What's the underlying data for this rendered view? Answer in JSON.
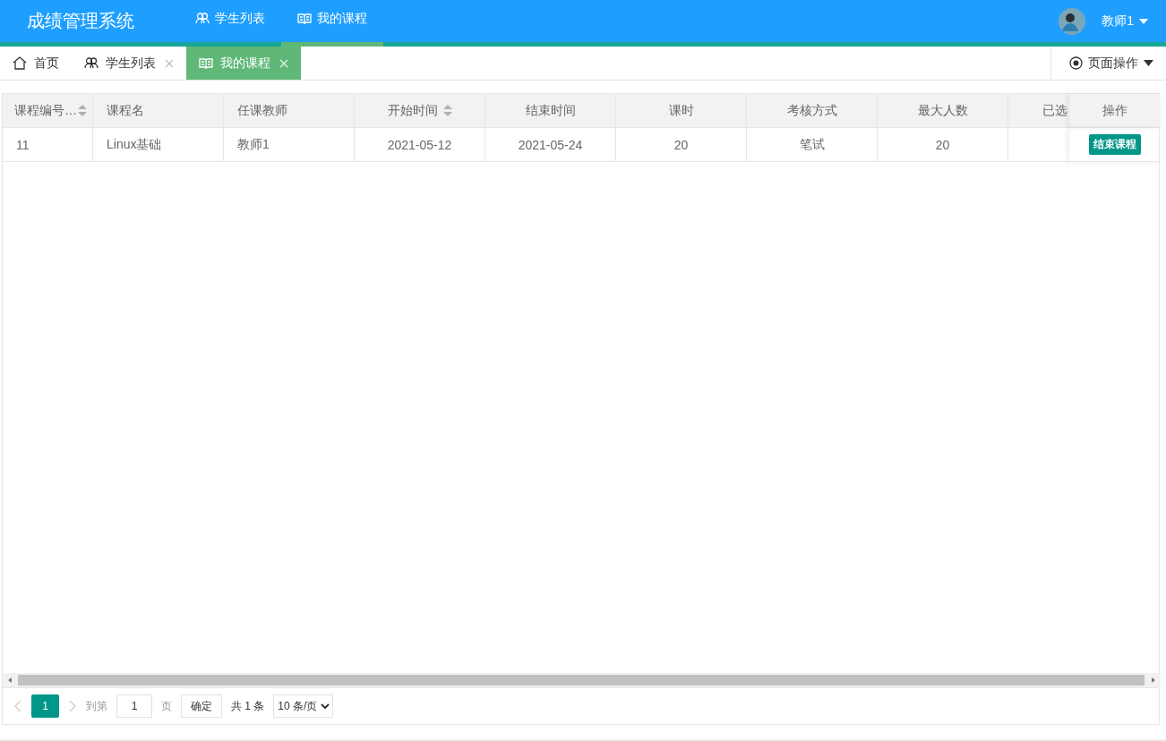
{
  "header": {
    "title": "成绩管理系统",
    "nav": [
      {
        "label": "学生列表",
        "kind": "users",
        "selected": false
      },
      {
        "label": "我的课程",
        "kind": "book",
        "selected": true
      }
    ],
    "user": {
      "name": "教师1"
    }
  },
  "tabs": [
    {
      "label": "首页",
      "kind": "home",
      "closable": false,
      "selected": false
    },
    {
      "label": "学生列表",
      "kind": "users",
      "closable": true,
      "selected": false
    },
    {
      "label": "我的课程",
      "kind": "book",
      "closable": true,
      "selected": true
    }
  ],
  "page_actions": {
    "label": "页面操作"
  },
  "table": {
    "columns": [
      {
        "label": "课程编号…",
        "sortable": true,
        "kind": "text"
      },
      {
        "label": "课程名",
        "sortable": false,
        "kind": "text"
      },
      {
        "label": "任课教师",
        "sortable": false,
        "kind": "text"
      },
      {
        "label": "开始时间",
        "sortable": true,
        "kind": "date"
      },
      {
        "label": "结束时间",
        "sortable": false,
        "kind": "date"
      },
      {
        "label": "课时",
        "sortable": false,
        "kind": "number"
      },
      {
        "label": "考核方式",
        "sortable": false,
        "kind": "number"
      },
      {
        "label": "最大人数",
        "sortable": false,
        "kind": "number"
      },
      {
        "label": "已选",
        "sortable": false,
        "kind": "cut"
      }
    ],
    "action_column": "操作",
    "rows": [
      {
        "cells": [
          "11",
          "Linux基础",
          "教师1",
          "2021-05-12",
          "2021-05-24",
          "20",
          "笔试",
          "20"
        ],
        "actions": [
          "结束课程"
        ]
      }
    ]
  },
  "pager": {
    "pages": [
      {
        "label": "1",
        "selected": true
      }
    ],
    "goto_label": "到第",
    "page_input": "1",
    "page_suffix": "页",
    "confirm": "确定",
    "total": "共 1 条",
    "page_size": "10 条/页"
  }
}
